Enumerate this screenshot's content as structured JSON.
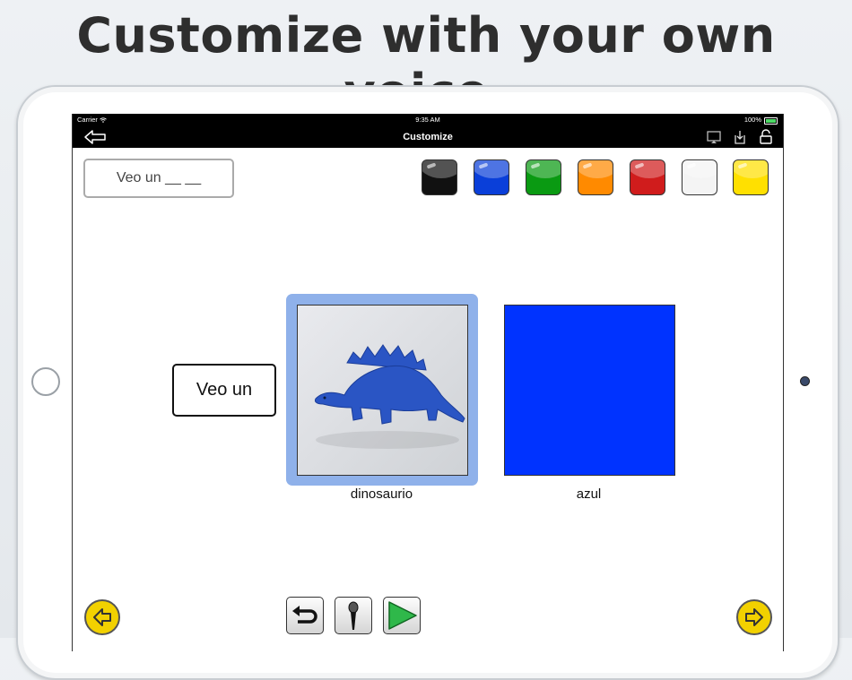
{
  "headline": "Customize with your own voice.",
  "status_bar": {
    "carrier": "Carrier",
    "time": "9:35 AM",
    "battery": "100%"
  },
  "nav": {
    "title": "Customize",
    "back_icon": "back-arrow-icon",
    "right_icons": [
      "display-icon",
      "download-icon",
      "lock-open-icon"
    ]
  },
  "phrase_button": {
    "label": "Veo un __ __"
  },
  "color_swatches": [
    {
      "name": "black",
      "color": "#111111"
    },
    {
      "name": "blue",
      "color": "#0a3fd9"
    },
    {
      "name": "green",
      "color": "#0a9a12"
    },
    {
      "name": "orange",
      "color": "#ff8a00"
    },
    {
      "name": "red",
      "color": "#d01c1c"
    },
    {
      "name": "white",
      "color": "#f4f4f4"
    },
    {
      "name": "yellow",
      "color": "#ffe000"
    }
  ],
  "sentence": {
    "prefix": "Veo un"
  },
  "cards": [
    {
      "caption": "dinosaurio",
      "selected": true,
      "image": "blue-dinosaur-photo"
    },
    {
      "caption": "azul",
      "selected": false,
      "color": "#0033ff"
    }
  ],
  "bottom": {
    "prev_icon": "arrow-left-icon",
    "next_icon": "arrow-right-icon",
    "undo_icon": "undo-icon",
    "mic_icon": "microphone-icon",
    "play_icon": "play-icon"
  }
}
